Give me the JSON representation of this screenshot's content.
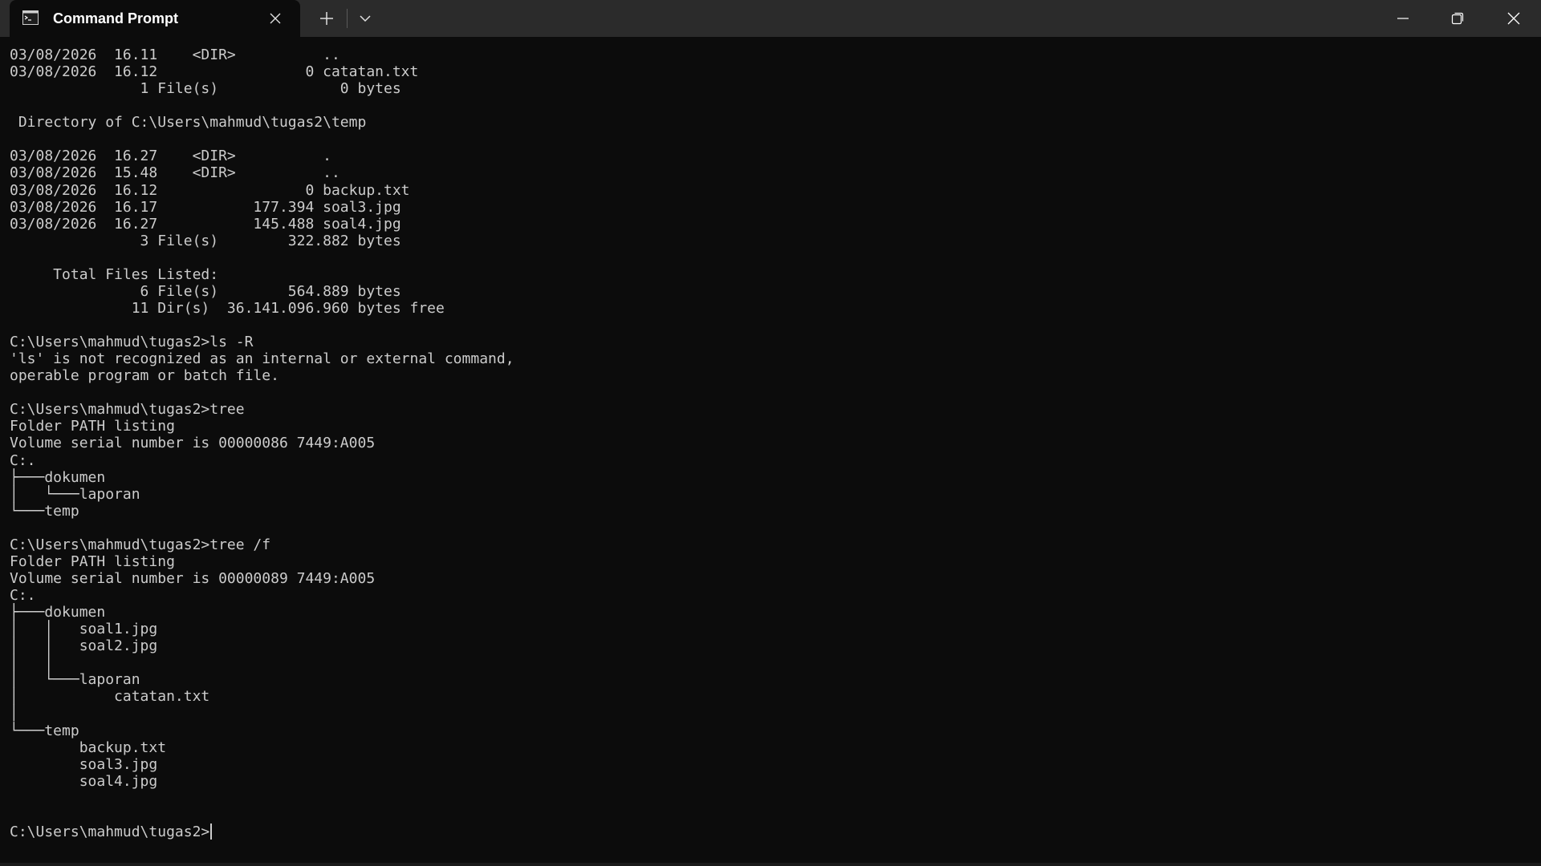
{
  "tab": {
    "title": "Command Prompt",
    "icon": "command-prompt-icon"
  },
  "titlebar": {
    "close_tab_icon": "close-icon",
    "new_tab_icon": "plus-icon",
    "dropdown_icon": "chevron-down-icon",
    "minimize_icon": "minimize-icon",
    "maximize_icon": "restore-icon",
    "close_icon": "close-icon"
  },
  "colors": {
    "titlebar_bg": "#2b2b2b",
    "terminal_bg": "#0c0c0c",
    "terminal_fg": "#cccccc"
  },
  "terminal": {
    "lines": [
      "03/08/2026  16.11    <DIR>          ..",
      "03/08/2026  16.12                 0 catatan.txt",
      "               1 File(s)              0 bytes",
      "",
      " Directory of C:\\Users\\mahmud\\tugas2\\temp",
      "",
      "03/08/2026  16.27    <DIR>          .",
      "03/08/2026  15.48    <DIR>          ..",
      "03/08/2026  16.12                 0 backup.txt",
      "03/08/2026  16.17           177.394 soal3.jpg",
      "03/08/2026  16.27           145.488 soal4.jpg",
      "               3 File(s)        322.882 bytes",
      "",
      "     Total Files Listed:",
      "               6 File(s)        564.889 bytes",
      "              11 Dir(s)  36.141.096.960 bytes free",
      "",
      "C:\\Users\\mahmud\\tugas2>ls -R",
      "'ls' is not recognized as an internal or external command,",
      "operable program or batch file.",
      "",
      "C:\\Users\\mahmud\\tugas2>tree",
      "Folder PATH listing",
      "Volume serial number is 00000086 7449:A005",
      "C:.",
      "├───dokumen",
      "│   └───laporan",
      "└───temp",
      "",
      "C:\\Users\\mahmud\\tugas2>tree /f",
      "Folder PATH listing",
      "Volume serial number is 00000089 7449:A005",
      "C:.",
      "├───dokumen",
      "│   │   soal1.jpg",
      "│   │   soal2.jpg",
      "│   │",
      "│   └───laporan",
      "│           catatan.txt",
      "│",
      "└───temp",
      "        backup.txt",
      "        soal3.jpg",
      "        soal4.jpg",
      "",
      "",
      "C:\\Users\\mahmud\\tugas2>"
    ]
  }
}
